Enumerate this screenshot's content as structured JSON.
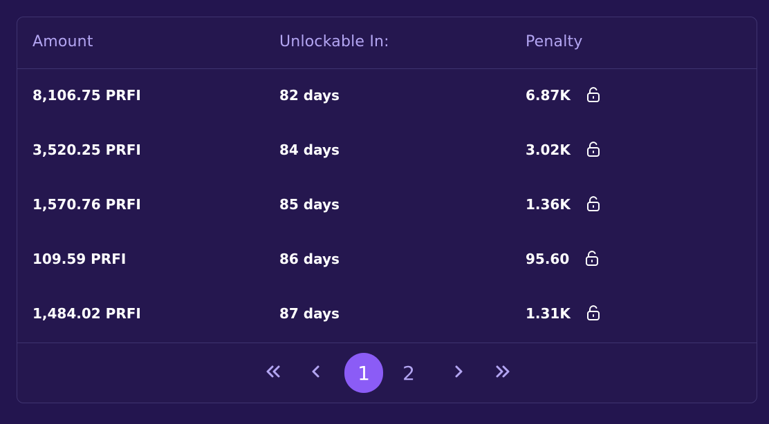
{
  "table": {
    "headers": {
      "amount": "Amount",
      "unlockable": "Unlockable In:",
      "penalty": "Penalty"
    },
    "rows": [
      {
        "amount": "8,106.75 PRFI",
        "unlockable": "82 days",
        "penalty": "6.87K"
      },
      {
        "amount": "3,520.25 PRFI",
        "unlockable": "84 days",
        "penalty": "3.02K"
      },
      {
        "amount": "1,570.76 PRFI",
        "unlockable": "85 days",
        "penalty": "1.36K"
      },
      {
        "amount": "109.59 PRFI",
        "unlockable": "86 days",
        "penalty": "95.60"
      },
      {
        "amount": "1,484.02 PRFI",
        "unlockable": "87 days",
        "penalty": "1.31K"
      }
    ]
  },
  "pagination": {
    "pages": [
      "1",
      "2"
    ],
    "current_page": "1",
    "icons": {
      "first": "double-chevron-left-icon",
      "prev": "chevron-left-icon",
      "next": "chevron-right-icon",
      "last": "double-chevron-right-icon"
    }
  },
  "row_icon": "unlock-icon",
  "colors": {
    "background": "#23154f",
    "header_text": "#b3a5f2",
    "active_page": "#8b5cf6",
    "row_text": "#ffffff"
  }
}
